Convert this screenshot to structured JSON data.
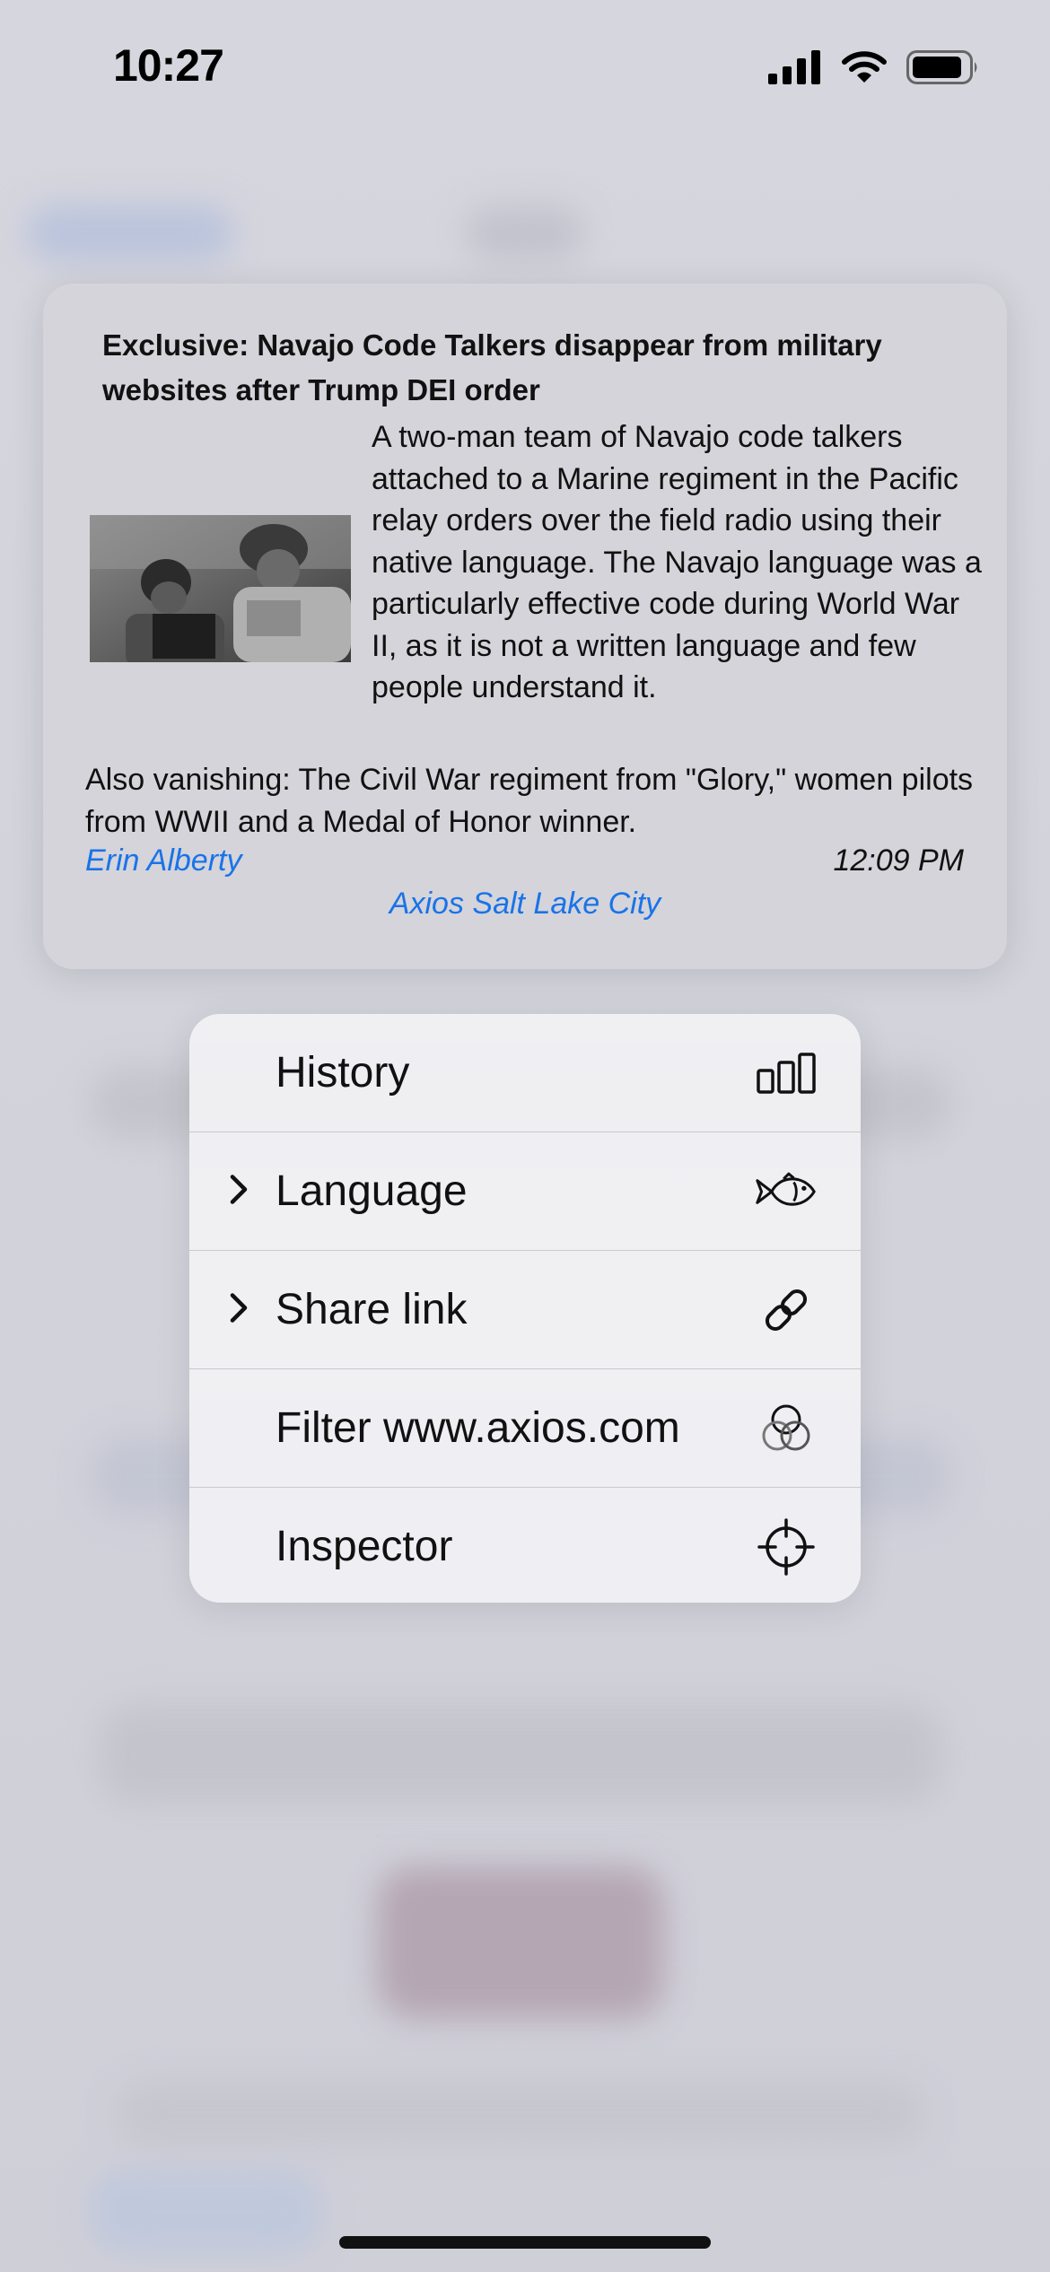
{
  "status": {
    "time": "10:27"
  },
  "card": {
    "title": "Exclusive: Navajo Code Talkers disappear from military websites after Trump DEI order",
    "summary": "A two-man team of Navajo code talkers attached to a Marine regiment in the Pacific relay orders over the field radio using their native language. The Navajo language was a particularly effective code during World War II, as it is not a written language and few people understand it.",
    "also": "Also vanishing: The Civil War regiment from \"Glory,\" women pilots from WWII and a Medal of Honor winner.",
    "author": "Erin Alberty",
    "time": "12:09 PM",
    "source": "Axios Salt Lake City"
  },
  "menu": {
    "items": [
      {
        "label": "History",
        "icon": "bar-chart-icon",
        "submenu": false
      },
      {
        "label": "Language",
        "icon": "fish-icon",
        "submenu": true
      },
      {
        "label": "Share link",
        "icon": "link-icon",
        "submenu": true
      },
      {
        "label": "Filter www.axios.com",
        "icon": "filter-circles-icon",
        "submenu": false
      },
      {
        "label": "Inspector",
        "icon": "crosshair-icon",
        "submenu": false
      }
    ]
  },
  "colors": {
    "link": "#1a73e8",
    "background": "#d3d3dc"
  }
}
